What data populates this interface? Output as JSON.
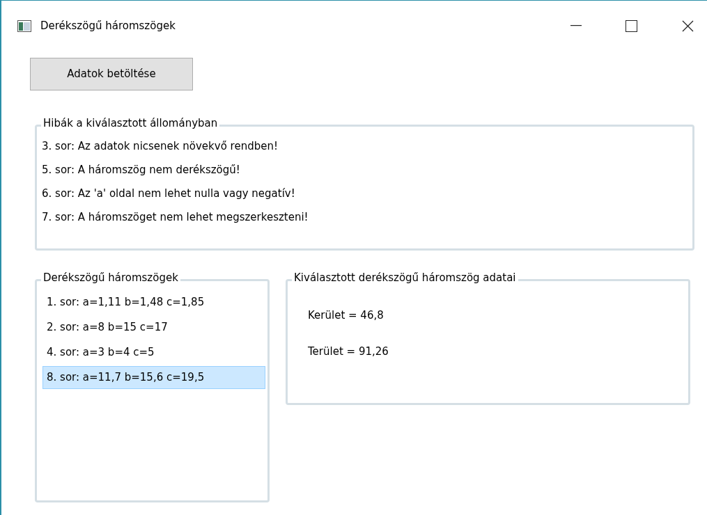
{
  "window": {
    "title": "Derékszögű háromszögek"
  },
  "load_button": "Adatok betöltése",
  "errors_group": {
    "title": "Hibák a kiválasztott állományban",
    "lines": [
      "3. sor: Az adatok nicsenek növekvő rendben!",
      "5. sor: A háromszög nem derékszögű!",
      "6. sor: Az 'a' oldal nem lehet nulla vagy negatív!",
      "7. sor: A háromszöget nem lehet megszerkeszteni!"
    ]
  },
  "triangles_group": {
    "title": "Derékszögű háromszögek",
    "items": [
      {
        "text": "1. sor: a=1,11 b=1,48 c=1,85",
        "selected": false
      },
      {
        "text": "2. sor: a=8 b=15 c=17",
        "selected": false
      },
      {
        "text": "4. sor: a=3 b=4 c=5",
        "selected": false
      },
      {
        "text": "8. sor: a=11,7 b=15,6 c=19,5",
        "selected": true
      }
    ]
  },
  "details_group": {
    "title": "Kiválasztott derékszögű háromszög adatai",
    "lines": [
      "Kerület = 46,8",
      "Terület = 91,26"
    ]
  }
}
